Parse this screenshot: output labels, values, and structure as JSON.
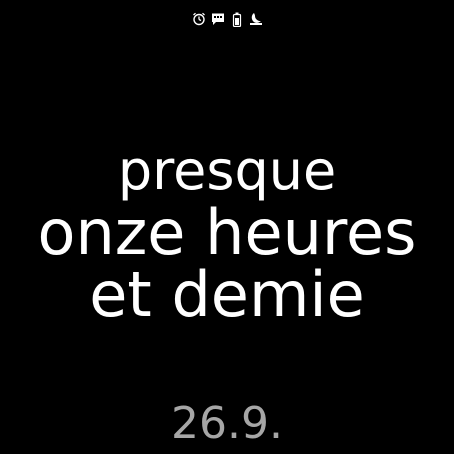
{
  "status_bar": {
    "icons": [
      "alarm-icon",
      "message-icon",
      "battery-icon",
      "bedtime-icon"
    ]
  },
  "watchface": {
    "time_line_1": "presque",
    "time_line_2": "onze heures",
    "time_line_3": "et demie",
    "date": "26.9."
  },
  "colors": {
    "background": "#000000",
    "time_text": "#ffffff",
    "date_text": "#a6a6a6"
  }
}
